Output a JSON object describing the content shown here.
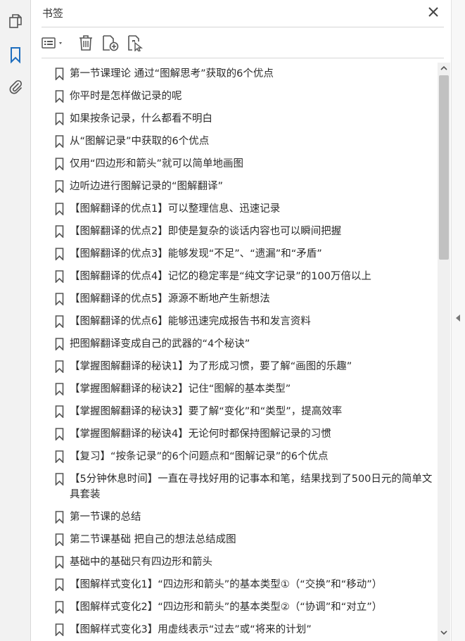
{
  "panel": {
    "title": "书签",
    "close_icon": "close-icon"
  },
  "left_rail": {
    "items": [
      {
        "name": "pages-icon",
        "active": false
      },
      {
        "name": "bookmark-icon",
        "active": true
      },
      {
        "name": "attachment-icon",
        "active": false
      }
    ]
  },
  "toolbar": {
    "buttons": [
      "options-menu-icon",
      "delete-icon",
      "new-bookmark-icon",
      "bookmark-from-selection-icon"
    ]
  },
  "colors": {
    "accent": "#1f6fbf",
    "icon": "#555555"
  },
  "bookmarks": [
    "第一节课理论  通过“图解思考”获取的6个优点",
    "你平时是怎样做记录的呢",
    "如果按条记录，什么都看不明白",
    "从“图解记录”中获取的6个优点",
    "仅用“四边形和箭头”就可以简单地画图",
    "边听边进行图解记录的“图解翻译”",
    "【图解翻译的优点1】可以整理信息、迅速记录",
    "【图解翻译的优点2】即使是复杂的谈话内容也可以瞬间把握",
    "【图解翻译的优点3】能够发现“不足”、“遗漏”和“矛盾”",
    "【图解翻译的优点4】记忆的稳定率是“纯文字记录”的100万倍以上",
    "【图解翻译的优点5】源源不断地产生新想法",
    "【图解翻译的优点6】能够迅速完成报告书和发言资料",
    "把图解翻译变成自己的武器的“4个秘诀”",
    "【掌握图解翻译的秘诀1】为了形成习惯，要了解“画图的乐趣”",
    "【掌握图解翻译的秘诀2】记住“图解的基本类型”",
    "【掌握图解翻译的秘诀3】要了解“变化”和“类型”，提高效率",
    "【掌握图解翻译的秘诀4】无论何时都保持图解记录的习惯",
    "【复习】“按条记录”的6个问题点和“图解记录”的6个优点",
    "【5分钟休息时间】一直在寻找好用的记事本和笔，结果找到了500日元的简单文具套装",
    "第一节课的总结",
    "第二节课基础  把自己的想法总结成图",
    "基础中的基础只有四边形和箭头",
    "【图解样式变化1】“四边形和箭头”的基本类型①（“交换”和“移动”）",
    "【图解样式变化2】“四边形和箭头”的基本类型②（“协调”和“对立”）",
    "【图解样式变化3】用虚线表示“过去”或“将来的计划”"
  ]
}
